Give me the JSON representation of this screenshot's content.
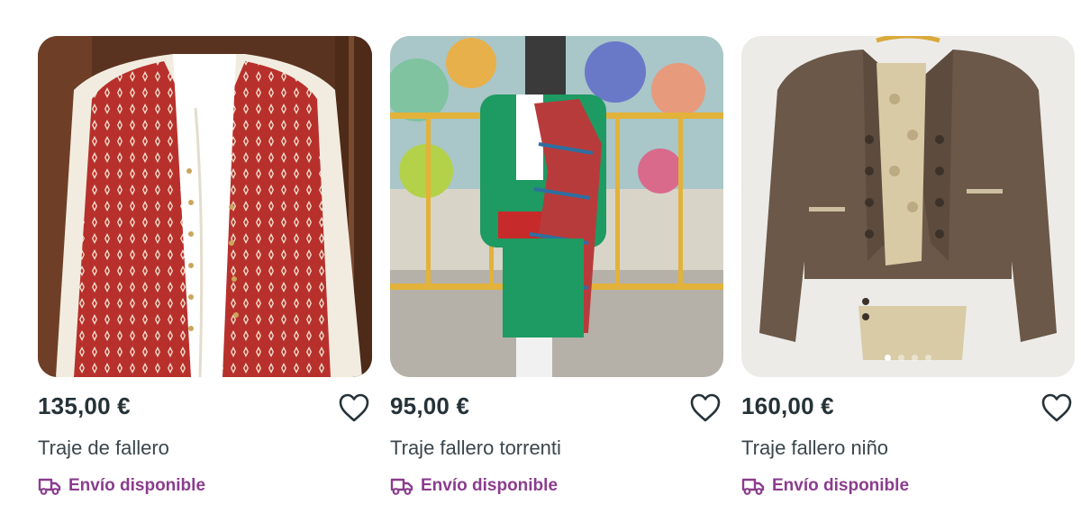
{
  "products": [
    {
      "price": "135,00 €",
      "title": "Traje de fallero",
      "shipping": "Envío disponible",
      "image_icon": "vest-photo",
      "favorite_icon": "heart-outline-icon",
      "shipping_icon": "truck-icon",
      "carousel": {
        "count": 1,
        "active": 1
      }
    },
    {
      "price": "95,00 €",
      "title": "Traje fallero torrenti",
      "shipping": "Envío disponible",
      "image_icon": "child-costume-photo",
      "favorite_icon": "heart-outline-icon",
      "shipping_icon": "truck-icon",
      "carousel": {
        "count": 0,
        "active": 0
      }
    },
    {
      "price": "160,00 €",
      "title": "Traje fallero niño",
      "shipping": "Envío disponible",
      "image_icon": "jacket-photo",
      "favorite_icon": "heart-outline-icon",
      "shipping_icon": "truck-icon",
      "carousel": {
        "count": 4,
        "active": 1
      }
    }
  ],
  "colors": {
    "price_text": "#253238",
    "shipping_text": "#8a3d8e",
    "background": "#ffffff"
  }
}
